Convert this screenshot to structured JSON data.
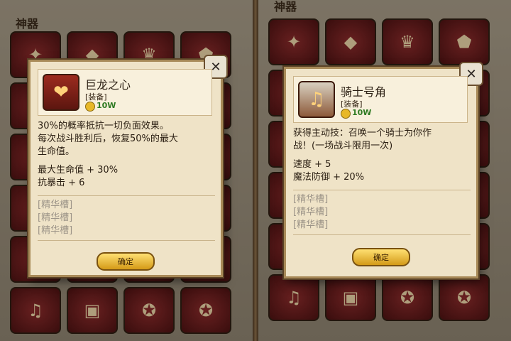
{
  "left": {
    "section_title": "神器",
    "item": {
      "name": "巨龙之心",
      "type": "[装备]",
      "price": "10W",
      "icon": "dragon-heart-icon"
    },
    "description": "30%的概率抵抗一切负面效果。\n每次战斗胜利后，恢复50%的最大\n生命值。",
    "stats": "最大生命值 + 30%\n抗暴击 + 6",
    "gem_slots": [
      "[精华槽]",
      "[精华槽]",
      "[精华槽]"
    ],
    "confirm_label": "确定"
  },
  "right": {
    "section_title": "神器",
    "item": {
      "name": "骑士号角",
      "type": "[装备]",
      "price": "10W",
      "icon": "knight-horn-icon"
    },
    "description": "获得主动技：召唤一个骑士为你作\n战！(一场战斗限用一次)",
    "stats": "速度 + 5\n魔法防御 + 20%",
    "gem_slots": [
      "[精华槽]",
      "[精华槽]",
      "[精华槽]"
    ],
    "confirm_label": "确定"
  },
  "colors": {
    "price_green": "#2e7a22",
    "slot_red": "#8b2b2b",
    "button_gold": "#f2c23c"
  }
}
